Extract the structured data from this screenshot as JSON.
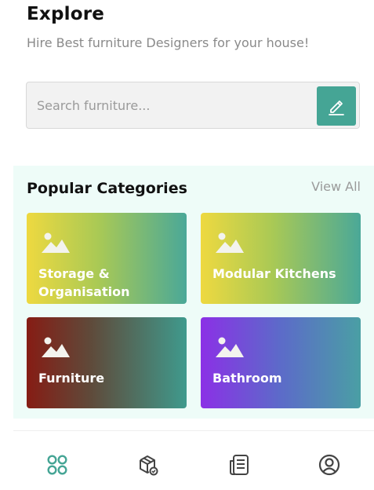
{
  "header": {
    "title": "Explore",
    "subtitle": "Hire Best furniture Designers for your house!"
  },
  "search": {
    "placeholder": "Search furniture...",
    "value": "",
    "button_icon": "pencil-icon"
  },
  "categories": {
    "title": "Popular Categories",
    "view_all": "View All",
    "items": [
      {
        "label": "Storage &\nOrganisation",
        "icon": "image-icon"
      },
      {
        "label": "Modular Kitchens",
        "icon": "image-icon"
      },
      {
        "label": "Furniture",
        "icon": "image-icon"
      },
      {
        "label": "Bathroom",
        "icon": "image-icon"
      }
    ]
  },
  "nav": {
    "items": [
      {
        "icon": "grid-icon",
        "active": true
      },
      {
        "icon": "package-icon",
        "active": false
      },
      {
        "icon": "document-list-icon",
        "active": false
      },
      {
        "icon": "profile-icon",
        "active": false
      }
    ]
  },
  "colors": {
    "accent": "#45a595",
    "category_bg": "#eefcf8",
    "nav_active": "#45a595",
    "nav_inactive": "#444444"
  }
}
